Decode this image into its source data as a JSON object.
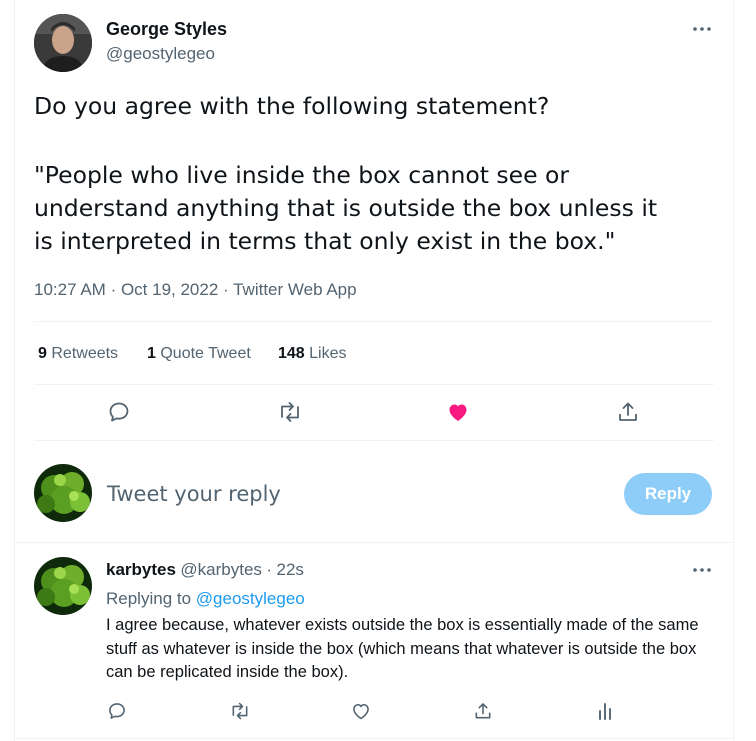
{
  "tweet": {
    "author_name": "George Styles",
    "author_handle": "@geostylegeo",
    "text_line1": "Do you agree with the following statement?",
    "text_quote": "\"People who live inside the box cannot see or\nunderstand anything that is outside the box unless it\nis interpreted in terms that only exist in the box.\"",
    "time": "10:27 AM",
    "date": "Oct 19, 2022",
    "source": "Twitter Web App",
    "retweet_count": "9",
    "retweet_label": "Retweets",
    "quote_count": "1",
    "quote_label": "Quote Tweet",
    "like_count": "148",
    "like_label": "Likes",
    "liked": true
  },
  "composer": {
    "placeholder": "Tweet your reply",
    "button_label": "Reply"
  },
  "reply": {
    "author_name": "karbytes",
    "author_handle": "@karbytes",
    "age": "22s",
    "replying_prefix": "Replying to",
    "replying_to": "@geostylegeo",
    "text": "I agree because, whatever exists outside the box is essentially made of the same stuff as whatever is inside the box (which means that whatever is outside the box can be replicated inside the box)."
  },
  "colors": {
    "accent": "#1d9bf0",
    "like": "#f91880",
    "muted": "#536471",
    "reply_button_disabled": "#8ecdf8"
  },
  "icons": [
    "more-icon",
    "reply-icon",
    "retweet-icon",
    "heart-icon",
    "share-icon",
    "analytics-icon"
  ]
}
